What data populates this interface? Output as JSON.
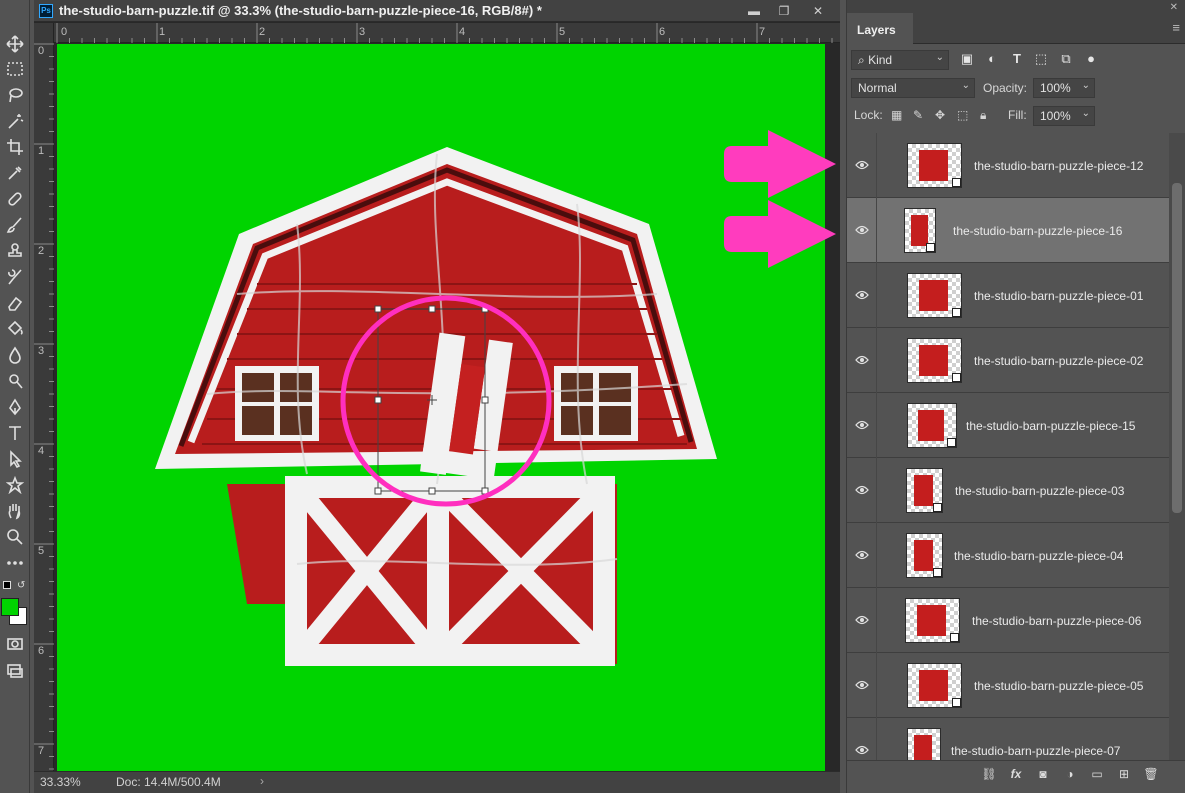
{
  "document": {
    "title": "the-studio-barn-puzzle.tif @ 33.3% (the-studio-barn-puzzle-piece-16, RGB/8#) *",
    "app_badge": "Ps",
    "zoom": "33.33%",
    "doc_info": "Doc: 14.4M/500.4M",
    "ruler_top": [
      "0",
      "1",
      "2",
      "3",
      "4",
      "5",
      "6",
      "7"
    ],
    "ruler_left": [
      "0",
      "1",
      "2",
      "3",
      "4",
      "5",
      "6",
      "7"
    ],
    "canvas_color": "#00d400"
  },
  "window_controls": {
    "minimize": "▬",
    "restore": "❐",
    "close": "✕"
  },
  "toolbar": {
    "tools": [
      "move-icon",
      "marquee-icon",
      "lasso-icon",
      "magic-wand-icon",
      "crop-icon",
      "eyedropper-icon",
      "healing-icon",
      "brush-icon",
      "stamp-icon",
      "history-brush-icon",
      "eraser-icon",
      "paint-bucket-icon",
      "blur-icon",
      "dodge-icon",
      "pen-icon",
      "type-icon",
      "path-select-icon",
      "shape-icon",
      "hand-icon",
      "zoom-icon",
      "more-icon"
    ],
    "foreground_color": "#00d400",
    "background_color": "#ffffff"
  },
  "layers_panel": {
    "tab_label": "Layers",
    "filter_kind": "Kind",
    "blend_mode": "Normal",
    "opacity_label": "Opacity:",
    "opacity_value": "100%",
    "lock_label": "Lock:",
    "fill_label": "Fill:",
    "fill_value": "100%",
    "layers": [
      {
        "name": "the-studio-barn-puzzle-piece-12",
        "selected": false
      },
      {
        "name": "the-studio-barn-puzzle-piece-16",
        "selected": true
      },
      {
        "name": "the-studio-barn-puzzle-piece-01",
        "selected": false
      },
      {
        "name": "the-studio-barn-puzzle-piece-02",
        "selected": false
      },
      {
        "name": "the-studio-barn-puzzle-piece-15",
        "selected": false
      },
      {
        "name": "the-studio-barn-puzzle-piece-03",
        "selected": false
      },
      {
        "name": "the-studio-barn-puzzle-piece-04",
        "selected": false
      },
      {
        "name": "the-studio-barn-puzzle-piece-06",
        "selected": false
      },
      {
        "name": "the-studio-barn-puzzle-piece-05",
        "selected": false
      },
      {
        "name": "the-studio-barn-puzzle-piece-07",
        "selected": false
      }
    ],
    "footer_fx": "fx"
  },
  "annotation": {
    "arrow_color": "#ff3cbe",
    "circle_color": "#ff2fbf"
  }
}
